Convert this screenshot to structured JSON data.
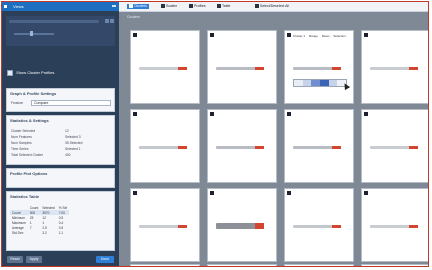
{
  "panel": {
    "title": "Views",
    "show_label": "Show Cluster Profiles",
    "graph_settings": {
      "header": "Graph & Profile Settings",
      "row_label": "Feature",
      "select_value": "Compare"
    },
    "statistics": {
      "header": "Statistics & Settings",
      "rows": [
        {
          "k": "Cluster Selected",
          "v": "12"
        },
        {
          "k": "Num Features",
          "v": "Selected 3"
        },
        {
          "k": "Num Samples",
          "v": "35 Selected"
        },
        {
          "k": "Time Series",
          "v": "Selected 1"
        },
        {
          "k": "Total Selected Cluster",
          "v": "400"
        }
      ]
    },
    "profile_header": "Profile Plot Options",
    "table": {
      "header": "Statistics Table",
      "columns": [
        "",
        "Count",
        "Selected",
        "% Sel"
      ],
      "rows": [
        [
          "Count",
          "500",
          "3570",
          "7.00"
        ],
        [
          "Minimum",
          "25",
          "12",
          "0.5"
        ],
        [
          "Maximum",
          "1",
          "1",
          "0.4"
        ],
        [
          "Average",
          "7",
          "2.5",
          "0.5"
        ],
        [
          "Std Dev",
          "",
          "3.2",
          "1.1"
        ]
      ]
    },
    "buttons": {
      "reset": "Reset",
      "apply": "Apply",
      "ok": "Done"
    }
  },
  "toolbar": {
    "active": "Clusters",
    "items": [
      "Scatter",
      "Profiles",
      "Table",
      "Select/Deselect All"
    ]
  },
  "grid": {
    "header": "Clusters"
  },
  "tile_legend": {
    "a": "Cluster 1",
    "b": "Range",
    "c": "Mean",
    "d": "Selection"
  },
  "colors": {
    "accent": "#2f7fd6",
    "panel_bg": "#2b3f58",
    "grid_bg": "#7f8895",
    "highlight": "#d2452f",
    "frame": "#c0392b"
  },
  "tiles": [
    {
      "bar_color": "#c9ccd1"
    },
    {
      "bar_color": "#b9bcc3"
    },
    {
      "bar_color": "#b9bcc3",
      "expanded": true
    },
    {
      "bar_color": "#c9ccd1"
    },
    {
      "bar_color": "#c4c7cc"
    },
    {
      "bar_color": "#b9bcc3"
    },
    {
      "bar_color": "#b9bcc3"
    },
    {
      "bar_color": "#c9ccd1"
    },
    {
      "bar_color": "#c9ccd1"
    },
    {
      "bar_color": "#8d9097"
    },
    {
      "bar_color": "#c4c7cc"
    },
    {
      "bar_color": "#c9ccd1"
    },
    {
      "bar_color": "#c9ccd1"
    },
    {
      "bar_color": "#c9ccd1"
    },
    {
      "bar_color": "#c9ccd1"
    },
    {
      "bar_color": "#c9ccd1"
    }
  ]
}
